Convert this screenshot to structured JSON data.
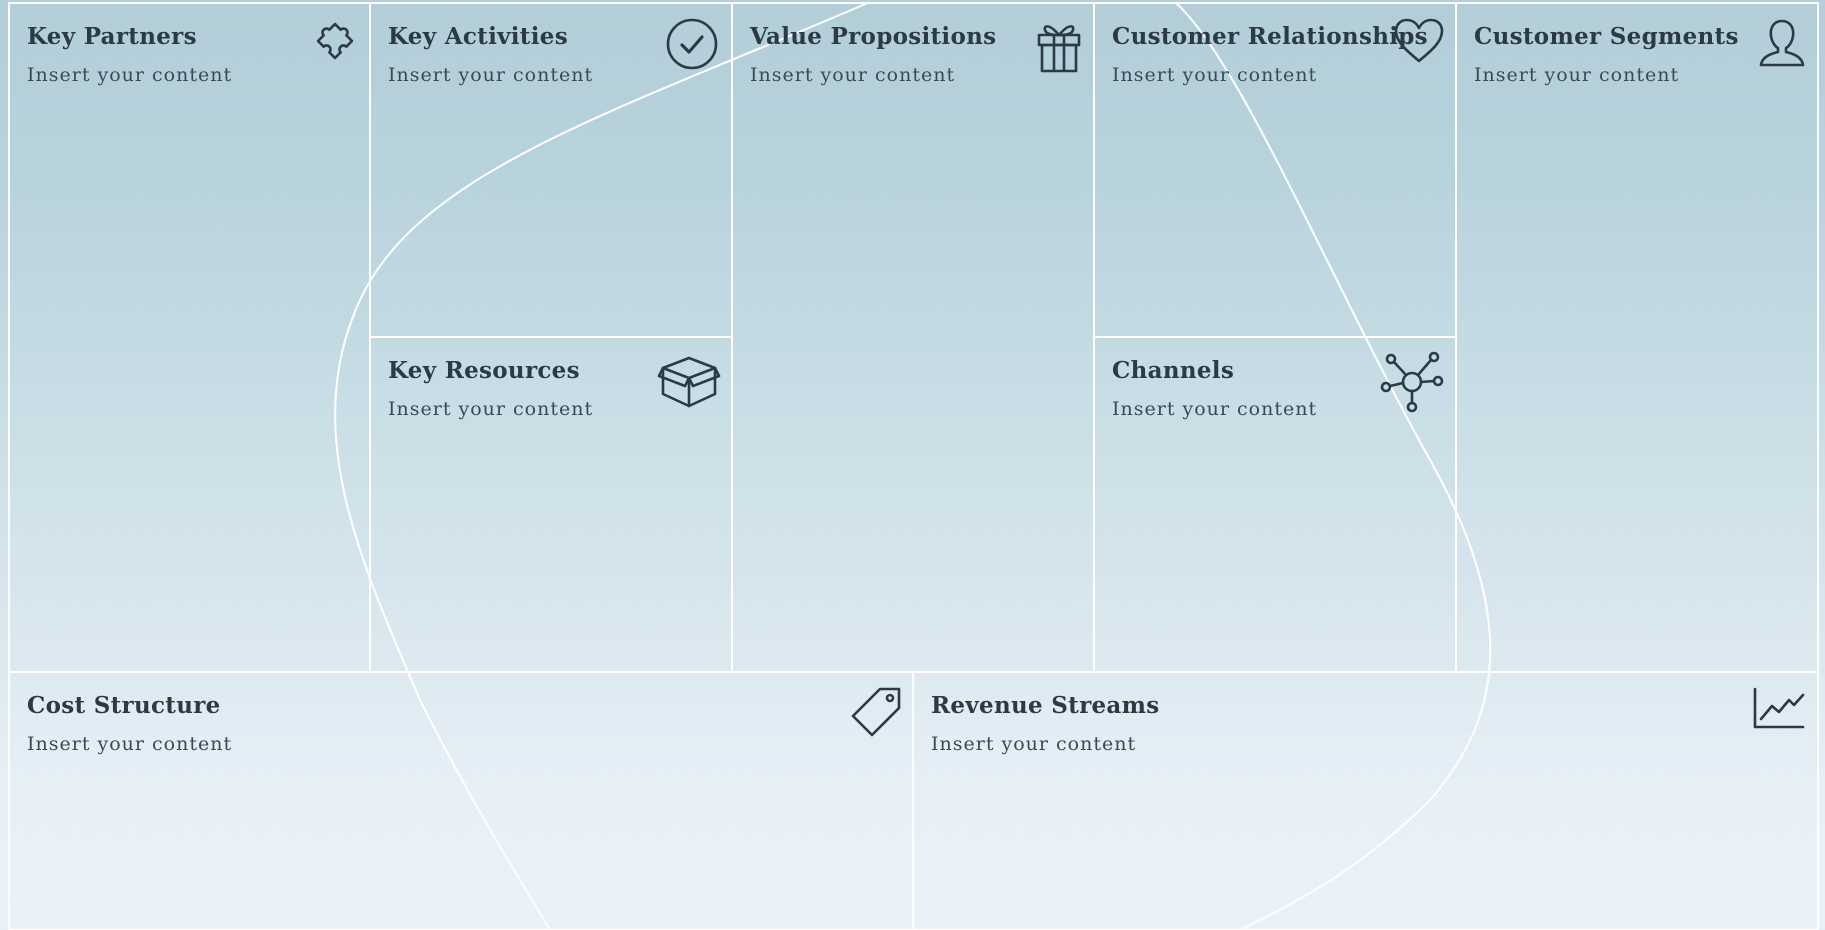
{
  "canvas": {
    "key_partners": {
      "title": "Key Partners",
      "text": "Insert your content",
      "icon": "puzzle-icon"
    },
    "key_activities": {
      "title": "Key Activities",
      "text": "Insert your content",
      "icon": "check-circle-icon"
    },
    "key_resources": {
      "title": "Key Resources",
      "text": "Insert your content",
      "icon": "box-icon"
    },
    "value_propositions": {
      "title": "Value Propositions",
      "text": "Insert your content",
      "icon": "gift-icon"
    },
    "customer_relationships": {
      "title": "Customer Relationships",
      "text": "Insert your content",
      "icon": "heart-icon"
    },
    "channels": {
      "title": "Channels",
      "text": "Insert your content",
      "icon": "network-icon"
    },
    "customer_segments": {
      "title": "Customer Segments",
      "text": "Insert your content",
      "icon": "user-icon"
    },
    "cost_structure": {
      "title": "Cost Structure",
      "text": "Insert your content",
      "icon": "tag-icon"
    },
    "revenue_streams": {
      "title": "Revenue Streams",
      "text": "Insert your content",
      "icon": "line-chart-icon"
    }
  },
  "colors": {
    "gradient_top": "#b3ced8",
    "gradient_bottom": "#eaf2f9",
    "border": "#ffffff",
    "text": "#2b3a44"
  }
}
